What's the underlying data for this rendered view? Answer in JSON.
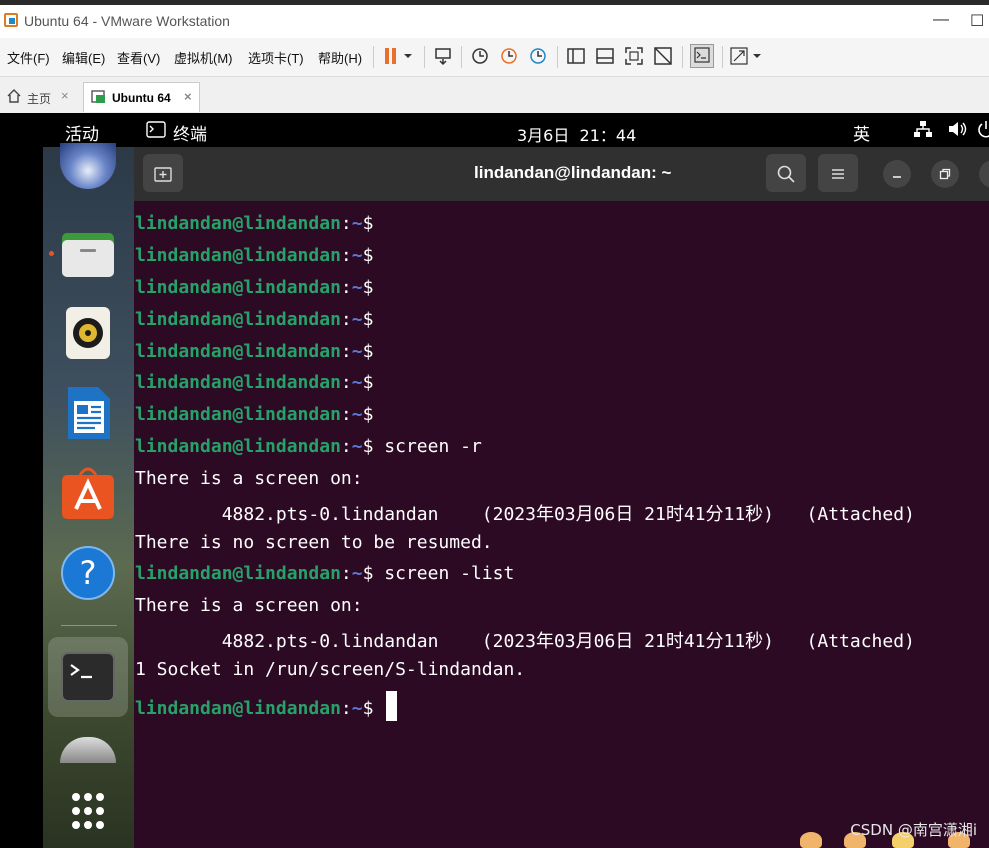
{
  "window": {
    "title": "Ubuntu 64 - VMware Workstation",
    "minimize": "—",
    "maximize": "☐"
  },
  "menubar": {
    "items": [
      "文件(F)",
      "编辑(E)",
      "查看(V)",
      "虚拟机(M)",
      "选项卡(T)",
      "帮助(H)"
    ]
  },
  "tabs": {
    "home": "主页",
    "vm": "Ubuntu 64",
    "close": "×"
  },
  "gnome": {
    "activities": "活动",
    "app": "终端",
    "clock": "3月6日  21：44",
    "ime": "英"
  },
  "terminal": {
    "title": "lindandan@lindandan: ~",
    "prompt_user": "lindandan@lindandan",
    "prompt_colon": ":",
    "prompt_path": "~",
    "prompt_sign": "$",
    "cmd1": " screen -r",
    "out1": "There is a screen on:",
    "out2": "        4882.pts-0.lindandan    (2023年03月06日 21时41分11秒)   (Attached)",
    "out3": "There is no screen to be resumed.",
    "cmd2": " screen -list",
    "out4": "There is a screen on:",
    "out5": "        4882.pts-0.lindandan    (2023年03月06日 21时41分11秒)   (Attached)",
    "out6": "1 Socket in /run/screen/S-lindandan."
  },
  "watermark": "CSDN @南宫潇湘i",
  "colors": {
    "terminal_bg": "#2c0a24",
    "prompt_user": "#26a269",
    "prompt_path": "#5a78d8",
    "accent": "#e95420"
  }
}
